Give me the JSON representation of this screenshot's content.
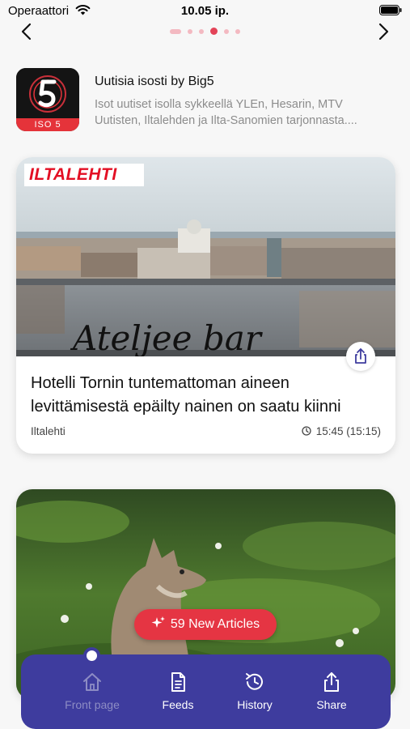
{
  "status_bar": {
    "carrier": "Operaattori",
    "time": "10.05 ip.",
    "wifi_icon": "wifi-icon",
    "battery_icon": "battery-icon"
  },
  "navigation": {
    "prev_icon": "chevron-left-icon",
    "next_icon": "chevron-right-icon",
    "page_count": 6,
    "active_page": 4
  },
  "feed": {
    "logo_text": "ISO 5",
    "title": "Uutisia isosti by Big5",
    "description": "Isot uutiset isolla sykkeellä YLEn, Hesarin, MTV Uutisten, Iltalehden ja Ilta-Sanomien tarjonnasta...."
  },
  "articles": [
    {
      "source_logo": "ILTALEHTI",
      "title": "Hotelli Tornin tuntemattoman aineen levittämisestä epäilty nainen on saatu kiinni",
      "source": "Iltalehti",
      "time": "15:45 (15:15)"
    }
  ],
  "new_articles_label": "59 New Articles",
  "tabs": [
    {
      "label": "Front page",
      "icon": "home-icon",
      "active": true
    },
    {
      "label": "Feeds",
      "icon": "document-icon",
      "active": false
    },
    {
      "label": "History",
      "icon": "history-icon",
      "active": false
    },
    {
      "label": "Share",
      "icon": "share-icon",
      "active": false
    }
  ],
  "colors": {
    "accent": "#e53543",
    "tab_bar": "#3e3c9e",
    "dot_active": "#e34358"
  }
}
